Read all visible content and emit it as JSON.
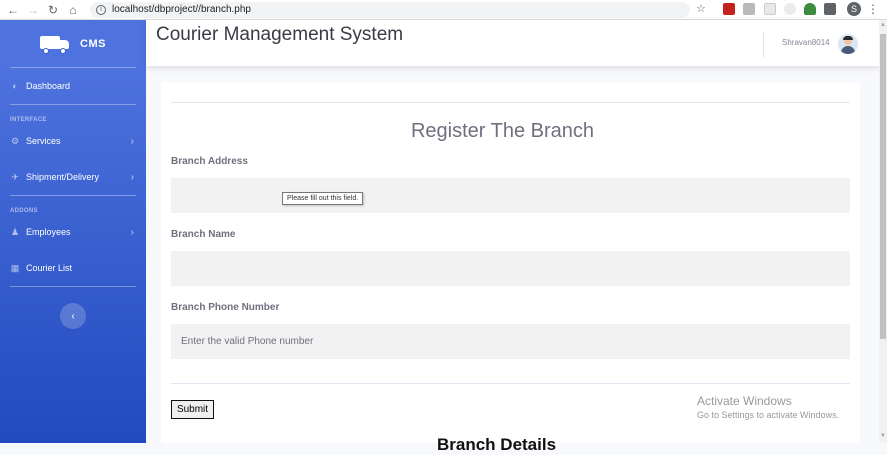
{
  "browser": {
    "url": "localhost/dbproject//branch.php",
    "profile_initial": "S"
  },
  "sidebar": {
    "brand": "CMS",
    "items": [
      {
        "label": "Dashboard",
        "icon": "gauge-icon"
      },
      {
        "label": "Services",
        "icon": "cog-icon"
      },
      {
        "label": "Shipment/Delivery",
        "icon": "plane-icon"
      },
      {
        "label": "Employees",
        "icon": "user-plus-icon"
      },
      {
        "label": "Courier List",
        "icon": "table-icon"
      }
    ],
    "headings": [
      "INTERFACE",
      "ADDONS"
    ]
  },
  "topbar": {
    "title": "Courier Management System",
    "username": "Shravan8014"
  },
  "form": {
    "title": "Register The Branch",
    "address_label": "Branch Address",
    "name_label": "Branch Name",
    "phone_label": "Branch Phone Number",
    "phone_placeholder": "Enter the valid Phone number",
    "validation_tooltip": "Please fill out this field.",
    "submit_label": "Submit",
    "next_heading": "Branch Details"
  },
  "watermark": {
    "line1": "Activate Windows",
    "line2": "Go to Settings to activate Windows."
  },
  "colors": {
    "sidebar_top": "#4e73df",
    "sidebar_bottom": "#224abe",
    "input_bg": "#f2f2f2"
  }
}
